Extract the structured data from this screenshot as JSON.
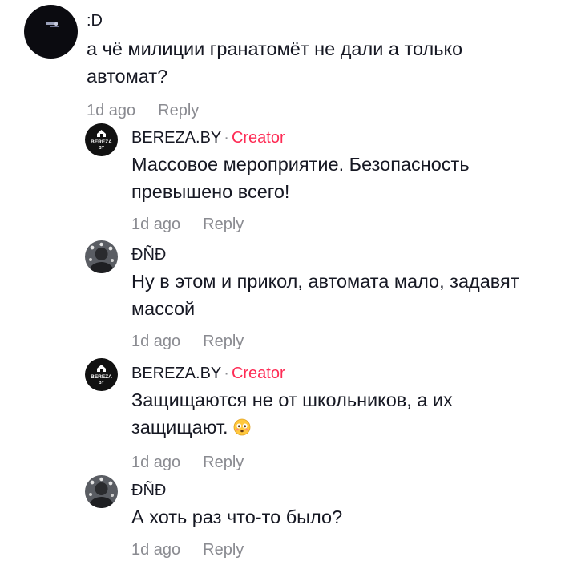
{
  "comments": [
    {
      "username": ":D",
      "text_lines": [
        "а чё милиции гранатомёт не дали а только",
        "автомат?"
      ],
      "time": "1d ago",
      "reply": "Reply"
    },
    {
      "username": "BEREZA.BY",
      "sep": "·",
      "badge": "Creator",
      "avatar_text": [
        "BEREZA",
        "BY"
      ],
      "text_lines": [
        "Массовое мероприятие. Безопасность",
        "превышено всего!"
      ],
      "time": "1d ago",
      "reply": "Reply"
    },
    {
      "username": "ĐÑĐ",
      "text_lines": [
        "Ну в этом и прикол, автомата мало, задавят",
        "массой"
      ],
      "time": "1d ago",
      "reply": "Reply"
    },
    {
      "username": "BEREZA.BY",
      "sep": "·",
      "badge": "Creator",
      "avatar_text": [
        "BEREZA",
        "BY"
      ],
      "text_lines": [
        "Защищаются не от школьников, а их",
        "защищают."
      ],
      "emoji": "flushed-face-emoji",
      "time": "1d ago",
      "reply": "Reply"
    },
    {
      "username": "ĐÑĐ",
      "text_lines": [
        "А хоть раз что-то было?"
      ],
      "time": "1d ago",
      "reply": "Reply"
    }
  ],
  "colors": {
    "creator": "#fe2c55",
    "meta": "#8a8b91",
    "text": "#161823"
  }
}
